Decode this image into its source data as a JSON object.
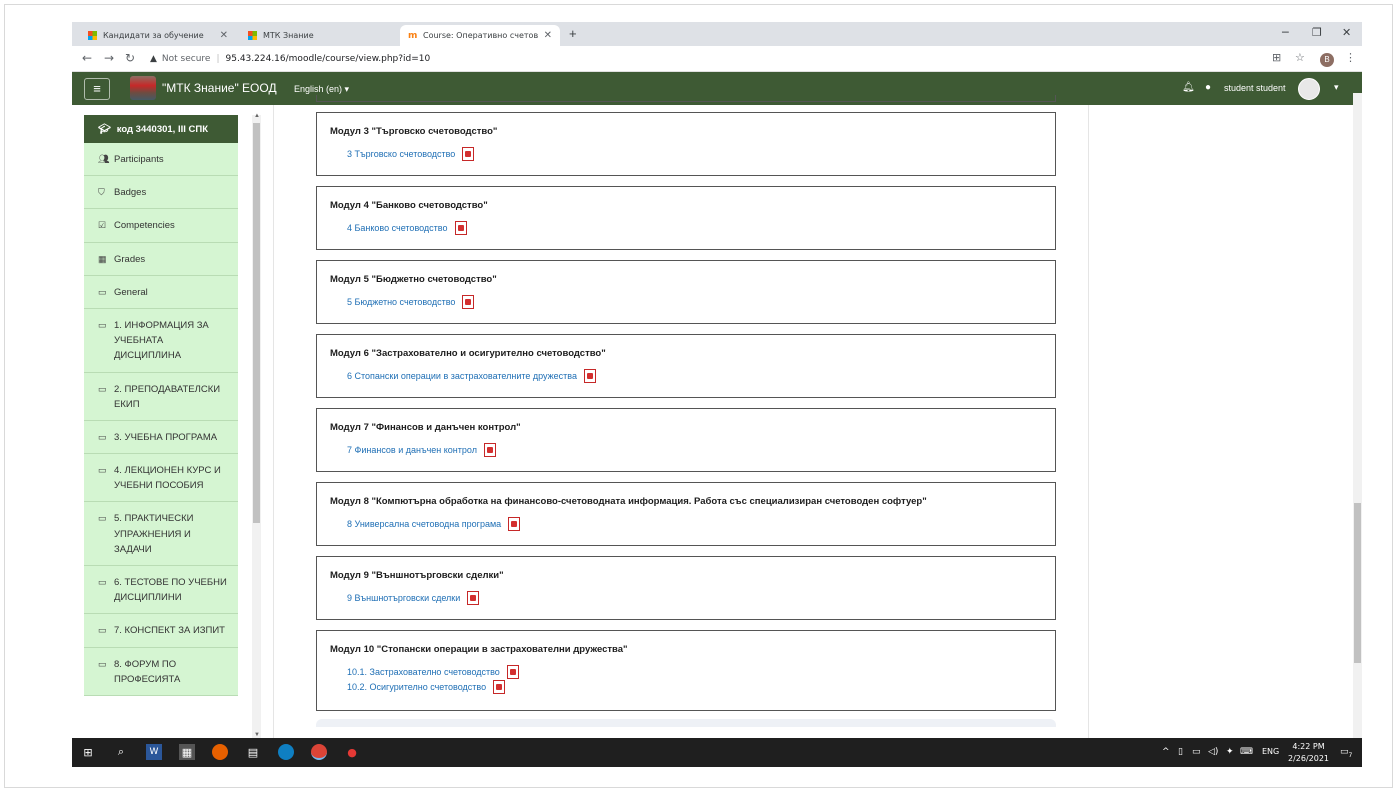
{
  "browser": {
    "tabs": [
      {
        "title": "Кандидати за обучение",
        "favicon": "microsoft-icon",
        "active": false
      },
      {
        "title": "МТК Знание",
        "favicon": "microsoft-icon",
        "active": false
      },
      {
        "title": "Course: Оперативно счетоводс",
        "favicon": "moodle-icon",
        "active": true
      }
    ],
    "new_tab": "+",
    "security": "Not secure",
    "url": "95.43.224.16/moodle/course/view.php?id=10",
    "profile_initial": "B"
  },
  "navbar": {
    "brand": "\"МТК Знание\" ЕООД",
    "language": "English (en)",
    "username": "student student"
  },
  "drawer": {
    "course": "код 3440301, III СПК",
    "items": [
      {
        "icon": "users-icon",
        "label": "Participants"
      },
      {
        "icon": "shield-icon",
        "label": "Badges"
      },
      {
        "icon": "checkbox-icon",
        "label": "Competencies"
      },
      {
        "icon": "table-icon",
        "label": "Grades"
      },
      {
        "icon": "folder-icon",
        "label": "General"
      },
      {
        "icon": "folder-icon",
        "label": "1. ИНФОРМАЦИЯ ЗА УЧЕБНАТА ДИСЦИПЛИНА"
      },
      {
        "icon": "folder-icon",
        "label": "2. ПРЕПОДАВАТЕЛСКИ ЕКИП"
      },
      {
        "icon": "folder-icon",
        "label": "3. УЧЕБНА ПРОГРАМА"
      },
      {
        "icon": "folder-icon",
        "label": "4. ЛЕКЦИОНЕН КУРС И УЧЕБНИ ПОСОБИЯ"
      },
      {
        "icon": "folder-icon",
        "label": "5. ПРАКТИЧЕСКИ УПРАЖНЕНИЯ И ЗАДАЧИ"
      },
      {
        "icon": "folder-icon",
        "label": "6. ТЕСТОВЕ ПО УЧЕБНИ ДИСЦИПЛИНИ"
      },
      {
        "icon": "folder-icon",
        "label": "7. КОНСПЕКТ ЗА ИЗПИТ"
      },
      {
        "icon": "folder-icon",
        "label": "8. ФОРУМ ПО ПРОФЕСИЯТА"
      }
    ]
  },
  "modules": [
    {
      "title": "Модул 3 \"Търговско счетоводство\"",
      "links": [
        "3 Търговско счетоводство"
      ]
    },
    {
      "title": "Модул 4 \"Банково счетоводство\"",
      "links": [
        "4 Банково счетоводство"
      ]
    },
    {
      "title": "Модул 5 \"Бюджетно счетоводство\"",
      "links": [
        "5 Бюджетно счетоводство"
      ]
    },
    {
      "title": "Модул 6 \"Застрахователно и осигурително счетоводство\"",
      "links": [
        "6 Стопански операции в застрахователните дружества"
      ]
    },
    {
      "title": "Модул 7 \"Финансов и данъчен контрол\"",
      "links": [
        "7 Финансов и данъчен контрол"
      ]
    },
    {
      "title": "Модул 8 \"Компютърна обработка на финансово-счетоводната информация. Работа със специализиран счетоводен софтуер\"",
      "links": [
        "8 Универсална счетоводна програма"
      ]
    },
    {
      "title": "Модул 9 \"Външнотърговски сделки\"",
      "links": [
        "9 Външнотърговски сделки"
      ]
    },
    {
      "title": "Модул 10 \"Стопански операции в застрахователни дружества\"",
      "links": [
        "10.1. Застрахователно счетоводство",
        "10.2. Осигурително счетоводство"
      ]
    }
  ],
  "taskbar": {
    "language": "ENG",
    "time": "4:22 PM",
    "date": "2/26/2021",
    "notifications": "7"
  }
}
